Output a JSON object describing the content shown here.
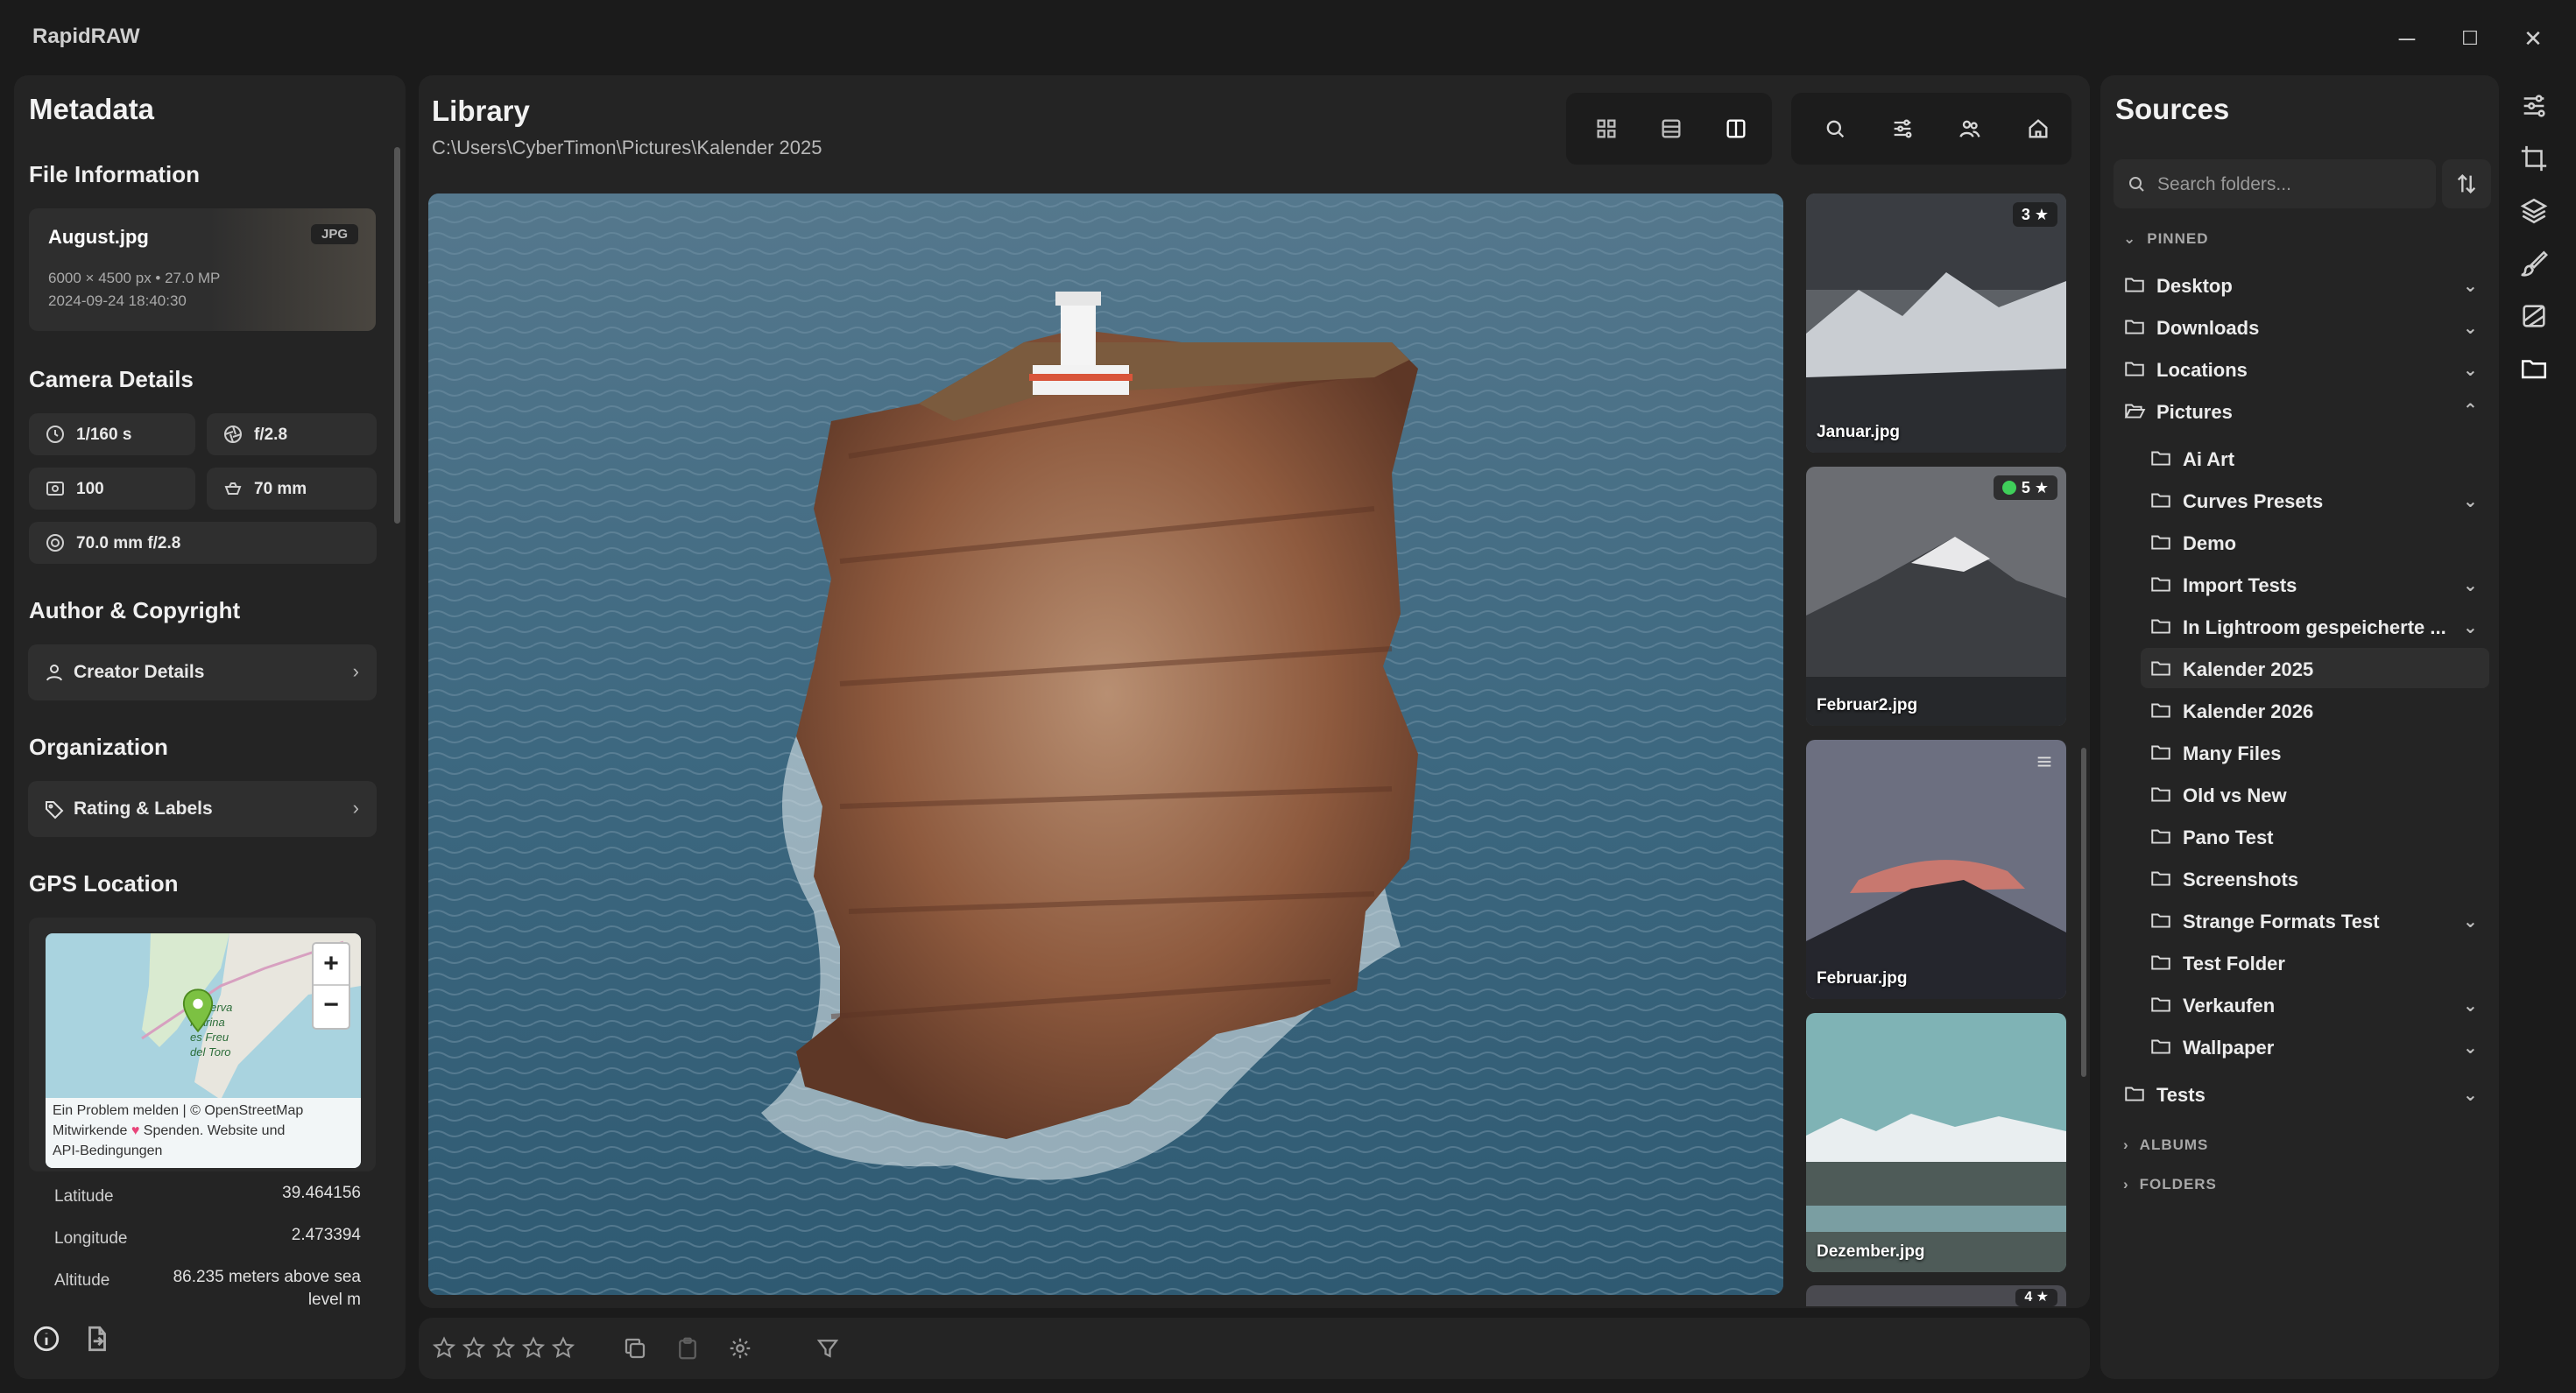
{
  "app": {
    "title": "RapidRAW"
  },
  "window": {
    "minimize": "─",
    "maximize": "☐",
    "close": "✕"
  },
  "metadata": {
    "title": "Metadata",
    "file_info": {
      "heading": "File Information",
      "filename": "August.jpg",
      "format": "JPG",
      "dimensions": "6000 × 4500 px • 27.0 MP",
      "datetime": "2024-09-24 18:40:30"
    },
    "camera": {
      "heading": "Camera Details",
      "shutter": "1/160 s",
      "aperture": "f/2.8",
      "iso": "100",
      "focal": "70 mm",
      "lens": "70.0 mm f/2.8"
    },
    "author": {
      "heading": "Author & Copyright",
      "creator_label": "Creator Details"
    },
    "organization": {
      "heading": "Organization",
      "rating_label": "Rating & Labels"
    },
    "gps": {
      "heading": "GPS Location",
      "map_attr_1": "Ein Problem melden | © OpenStreetMap",
      "map_attr_2a": "Mitwirkende",
      "map_attr_2b": "Spenden. Website und",
      "map_attr_3": "API-Bedingungen",
      "map_text_1": "Reserva",
      "map_text_2": "Marina",
      "map_text_3": "es Freu",
      "map_text_4": "del Toro",
      "latitude_label": "Latitude",
      "latitude": "39.464156",
      "longitude_label": "Longitude",
      "longitude": "2.473394",
      "altitude_label": "Altitude",
      "altitude_1": "86.235 meters above sea",
      "altitude_2": "level m"
    }
  },
  "library": {
    "title": "Library",
    "path": "C:\\Users\\CyberTimon\\Pictures\\Kalender 2025",
    "thumbnails": [
      {
        "name": "Januar.jpg",
        "badge": "3 ★"
      },
      {
        "name": "Februar2.jpg",
        "badge": "5 ★"
      },
      {
        "name": "Februar.jpg",
        "badge": ""
      },
      {
        "name": "Dezember.jpg",
        "badge": ""
      }
    ],
    "partial_badge": "4 ★"
  },
  "sources": {
    "title": "Sources",
    "search_placeholder": "Search folders...",
    "pinned_label": "PINNED",
    "albums_label": "ALBUMS",
    "folders_label": "FOLDERS",
    "pinned": [
      {
        "name": "Desktop"
      },
      {
        "name": "Downloads"
      },
      {
        "name": "Locations"
      },
      {
        "name": "Pictures"
      }
    ],
    "pictures_children": [
      {
        "name": "Ai Art"
      },
      {
        "name": "Curves Presets"
      },
      {
        "name": "Demo"
      },
      {
        "name": "Import Tests"
      },
      {
        "name": "In Lightroom gespeicherte ..."
      },
      {
        "name": "Kalender 2025"
      },
      {
        "name": "Kalender 2026"
      },
      {
        "name": "Many Files"
      },
      {
        "name": "Old vs New"
      },
      {
        "name": "Pano Test"
      },
      {
        "name": "Screenshots"
      },
      {
        "name": "Strange Formats Test"
      },
      {
        "name": "Test Folder"
      },
      {
        "name": "Verkaufen"
      },
      {
        "name": "Wallpaper"
      }
    ],
    "tests": {
      "name": "Tests"
    }
  },
  "colors": {
    "accent_green": "#3fcf5a",
    "map_pin": "#7cc142",
    "heart": "#e8457a"
  }
}
